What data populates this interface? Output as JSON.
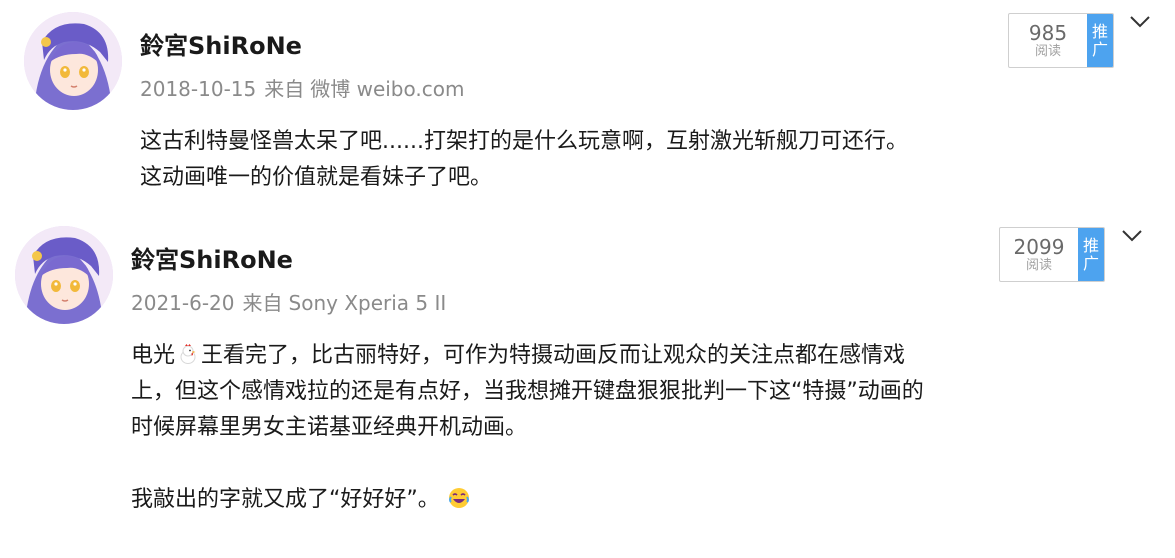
{
  "posts": [
    {
      "username": "鈴宮ShiRoNe",
      "date": "2018-10-15",
      "source_prefix": "来自",
      "source": "微博 weibo.com",
      "views": "985",
      "views_label": "阅读",
      "promote_label_1": "推",
      "promote_label_2": "广",
      "lines": [
        "这古利特曼怪兽太呆了吧......打架打的是什么玩意啊，互射激光斩舰刀可还行。",
        "这动画唯一的价值就是看妹子了吧。"
      ]
    },
    {
      "username": "鈴宮ShiRoNe",
      "date": "2021-6-20",
      "source_prefix": "来自",
      "source": "Sony Xperia 5 II",
      "views": "2099",
      "views_label": "阅读",
      "promote_label_1": "推",
      "promote_label_2": "广",
      "line1_pre": "电光",
      "line1_icon": "chicken-emoji-icon",
      "line1_post": "王看完了，比古丽特好，可作为特摄动画反而让观众的关注点都在感情戏",
      "line2": "上，但这个感情戏拉的还是有点好，当我想摊开键盘狠狠批判一下这“特摄”动画的",
      "line3": "时候屏幕里男女主诺基亚经典开机动画。",
      "line4": "我敲出的字就又成了“好好好”。",
      "line4_icon": "laughing-crying-emoji-icon"
    }
  ],
  "colors": {
    "promote_bg": "#4da3ef",
    "meta_text": "#8a8a8a",
    "border": "#cfcfcf"
  }
}
